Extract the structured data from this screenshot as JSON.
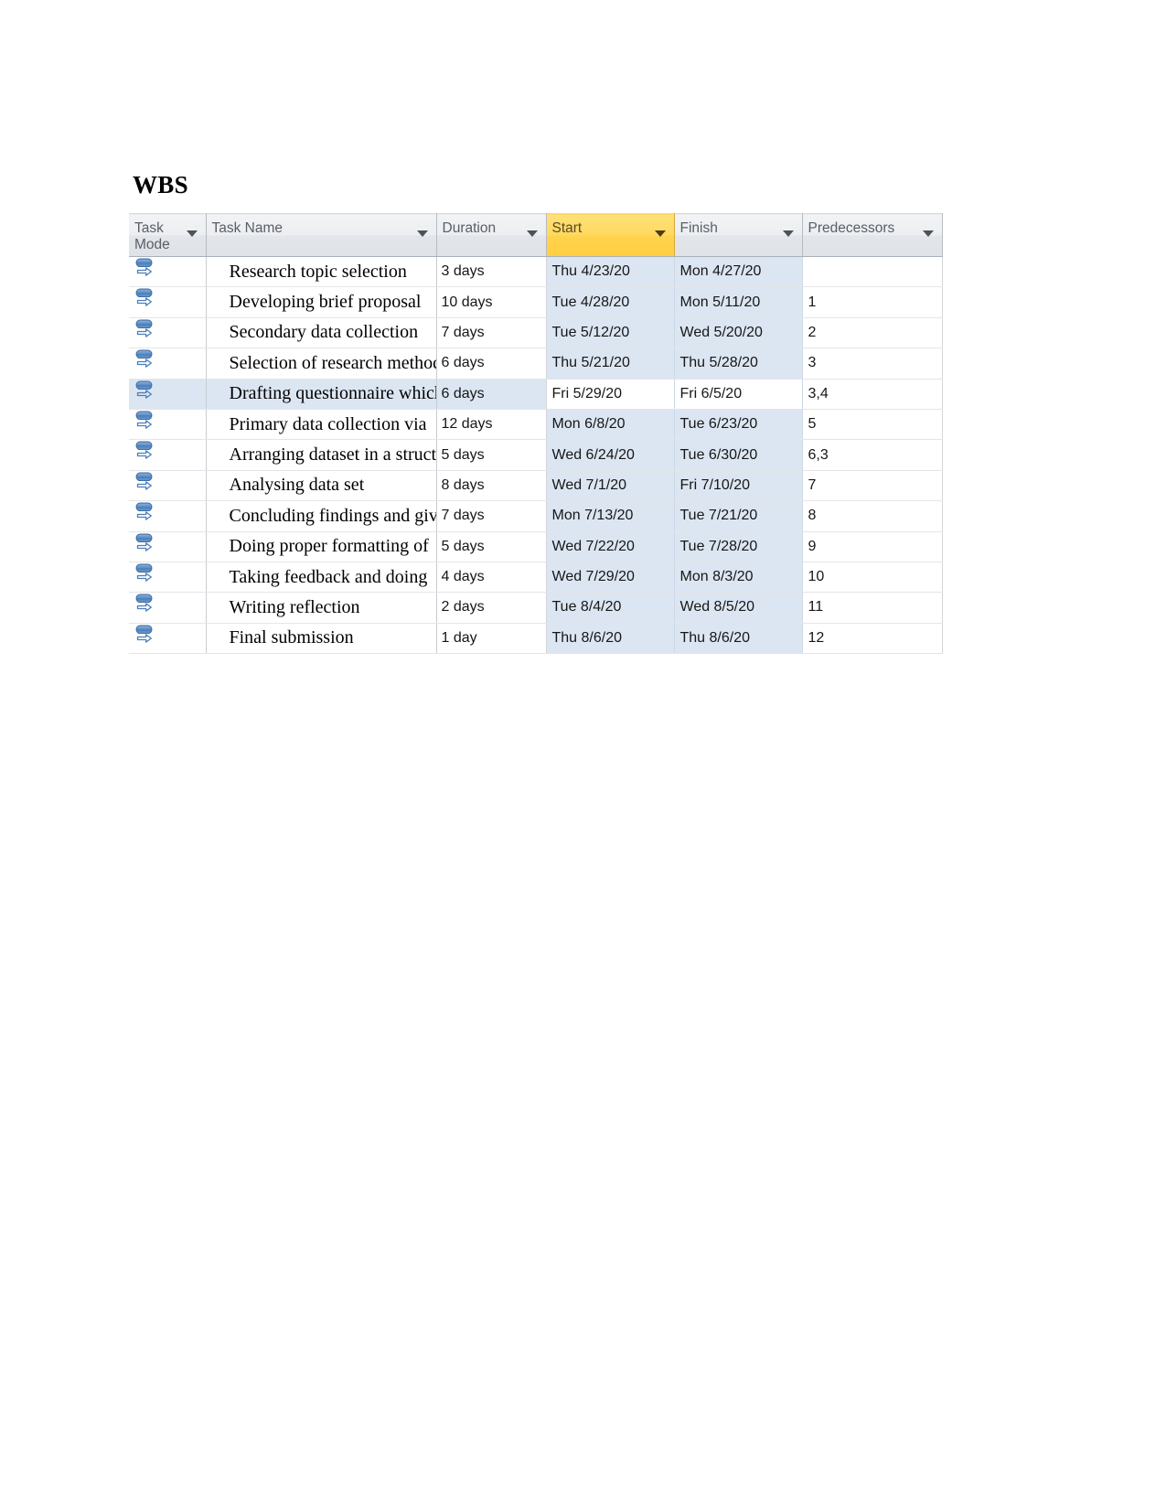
{
  "document": {
    "heading": "WBS"
  },
  "table": {
    "columns": [
      {
        "key": "task_mode",
        "label": "Task\nMode",
        "icon": "filter-dropdown-arrow-icon",
        "highlighted": false
      },
      {
        "key": "task_name",
        "label": "Task Name",
        "icon": "filter-dropdown-arrow-icon",
        "highlighted": false
      },
      {
        "key": "duration",
        "label": "Duration",
        "icon": "filter-dropdown-arrow-icon",
        "highlighted": false
      },
      {
        "key": "start",
        "label": "Start",
        "icon": "filter-dropdown-arrow-icon",
        "highlighted": true
      },
      {
        "key": "finish",
        "label": "Finish",
        "icon": "filter-dropdown-arrow-icon",
        "highlighted": false
      },
      {
        "key": "predecessors",
        "label": "Predecessors",
        "icon": "filter-dropdown-arrow-icon",
        "highlighted": false
      }
    ],
    "colors": {
      "header_highlight": "#ffd34d",
      "header_background": "#e5e8ec",
      "column_tint": "#dce6f2",
      "task_mode_icon": "#4a7ebb",
      "grid_line": "#d3d6da"
    },
    "selected_row_index": 4,
    "rows": [
      {
        "task_mode_icon": "auto-scheduled-task-icon",
        "task_name": "Research topic selection",
        "duration": "3 days",
        "start": "Thu 4/23/20",
        "finish": "Mon 4/27/20",
        "predecessors": ""
      },
      {
        "task_mode_icon": "auto-scheduled-task-icon",
        "task_name": "Developing brief proposal",
        "duration": "10 days",
        "start": "Tue 4/28/20",
        "finish": "Mon 5/11/20",
        "predecessors": "1"
      },
      {
        "task_mode_icon": "auto-scheduled-task-icon",
        "task_name": "Secondary data collection",
        "duration": "7 days",
        "start": "Tue 5/12/20",
        "finish": "Wed 5/20/20",
        "predecessors": "2"
      },
      {
        "task_mode_icon": "auto-scheduled-task-icon",
        "task_name": "Selection of research method",
        "duration": "6 days",
        "start": "Thu 5/21/20",
        "finish": "Thu 5/28/20",
        "predecessors": "3"
      },
      {
        "task_mode_icon": "auto-scheduled-task-icon",
        "task_name": "Drafting questionnaire which",
        "duration": "6 days",
        "start": "Fri 5/29/20",
        "finish": "Fri 6/5/20",
        "predecessors": "3,4"
      },
      {
        "task_mode_icon": "auto-scheduled-task-icon",
        "task_name": "Primary data collection via",
        "duration": "12 days",
        "start": "Mon 6/8/20",
        "finish": "Tue 6/23/20",
        "predecessors": "5"
      },
      {
        "task_mode_icon": "auto-scheduled-task-icon",
        "task_name": "Arranging dataset in a structure",
        "duration": "5 days",
        "start": "Wed 6/24/20",
        "finish": "Tue 6/30/20",
        "predecessors": "6,3"
      },
      {
        "task_mode_icon": "auto-scheduled-task-icon",
        "task_name": "Analysing data set",
        "duration": "8 days",
        "start": "Wed 7/1/20",
        "finish": "Fri 7/10/20",
        "predecessors": "7"
      },
      {
        "task_mode_icon": "auto-scheduled-task-icon",
        "task_name": "Concluding findings and giving",
        "duration": "7 days",
        "start": "Mon 7/13/20",
        "finish": "Tue 7/21/20",
        "predecessors": "8"
      },
      {
        "task_mode_icon": "auto-scheduled-task-icon",
        "task_name": "Doing proper formatting of",
        "duration": "5 days",
        "start": "Wed 7/22/20",
        "finish": "Tue 7/28/20",
        "predecessors": "9"
      },
      {
        "task_mode_icon": "auto-scheduled-task-icon",
        "task_name": "Taking feedback and doing",
        "duration": "4 days",
        "start": "Wed 7/29/20",
        "finish": "Mon 8/3/20",
        "predecessors": "10"
      },
      {
        "task_mode_icon": "auto-scheduled-task-icon",
        "task_name": "Writing reflection",
        "duration": "2 days",
        "start": "Tue 8/4/20",
        "finish": "Wed 8/5/20",
        "predecessors": "11"
      },
      {
        "task_mode_icon": "auto-scheduled-task-icon",
        "task_name": "Final submission",
        "duration": "1 day",
        "start": "Thu 8/6/20",
        "finish": "Thu 8/6/20",
        "predecessors": "12"
      }
    ]
  }
}
